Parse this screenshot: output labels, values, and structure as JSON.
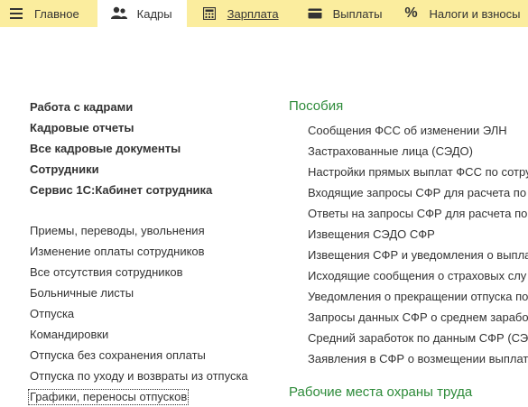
{
  "topbar": {
    "tabs": [
      {
        "label": "Главное",
        "icon": "menu-icon"
      },
      {
        "label": "Кадры",
        "icon": "people-icon"
      },
      {
        "label": "Зарплата",
        "icon": "calculator-icon"
      },
      {
        "label": "Выплаты",
        "icon": "wallet-icon"
      },
      {
        "label": "Налоги и взносы",
        "icon": "percent-icon"
      }
    ],
    "active_tab": "Кадры",
    "colors": {
      "bar": "#fbed9e",
      "active": "#ffffff"
    }
  },
  "left": {
    "main_links": [
      "Работа с кадрами",
      "Кадровые отчеты",
      "Все кадровые документы",
      "Сотрудники",
      "Сервис 1С:Кабинет сотрудника"
    ],
    "links": [
      "Приемы, переводы, увольнения",
      "Изменение оплаты сотрудников",
      "Все отсутствия сотрудников",
      "Больничные листы",
      "Отпуска",
      "Командировки",
      "Отпуска без сохранения оплаты",
      "Отпуска по уходу и возвраты из отпуска",
      "Графики, переносы отпусков"
    ]
  },
  "right": {
    "section1_title": "Пособия",
    "section1_links": [
      "Сообщения ФСС об изменении ЭЛН",
      "Застрахованные лица (СЭДО)",
      "Настройки прямых выплат ФСС по сотру",
      "Входящие запросы СФР для расчета по",
      "Ответы на запросы СФР для расчета по",
      "Извещения СЭДО СФР",
      "Извещения СФР и уведомления о выпла",
      "Исходящие сообщения о страховых слу",
      "Уведомления о прекращении отпуска по",
      "Запросы данных СФР о среднем заработ",
      "Средний заработок по данным СФР (СЭ",
      "Заявления в СФР о возмещении выплат"
    ],
    "section2_title": "Рабочие места охраны труда",
    "title_color": "#2e8b3a"
  }
}
